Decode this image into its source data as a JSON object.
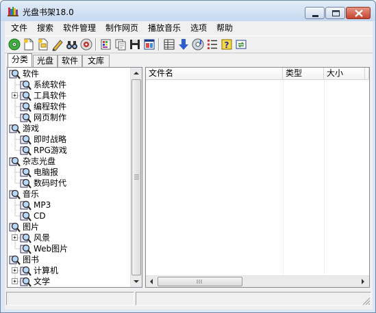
{
  "window": {
    "title": "光盘书架18.0",
    "icon": "bookshelf-icon"
  },
  "menu": [
    {
      "label": "文件"
    },
    {
      "label": "搜索"
    },
    {
      "label": "软件管理"
    },
    {
      "label": "制作网页"
    },
    {
      "label": "播放音乐"
    },
    {
      "label": "选项"
    },
    {
      "label": "帮助"
    }
  ],
  "toolbar": [
    {
      "icon": "disc-scan-icon"
    },
    {
      "icon": "new-file-icon"
    },
    {
      "icon": "new-folder-icon"
    },
    {
      "icon": "edit-pencil-icon"
    },
    {
      "icon": "binoculars-search-icon"
    },
    {
      "icon": "disc-player-icon"
    },
    {
      "icon": "color-palette-icon"
    },
    {
      "icon": "copy-icon"
    },
    {
      "icon": "save-icon"
    },
    {
      "icon": "window-layout-icon"
    },
    {
      "icon": "grid-view-icon"
    },
    {
      "icon": "arrow-down-icon"
    },
    {
      "icon": "disc-music-icon"
    },
    {
      "icon": "checklist-icon"
    },
    {
      "icon": "help-icon"
    },
    {
      "icon": "refresh-swap-icon"
    }
  ],
  "tabs": [
    {
      "label": "分类"
    },
    {
      "label": "光盘"
    },
    {
      "label": "软件"
    },
    {
      "label": "文库"
    }
  ],
  "tree": [
    {
      "label": "软件",
      "level": 0
    },
    {
      "label": "系统软件",
      "level": 1
    },
    {
      "label": "工具软件",
      "level": 1,
      "expandable": true
    },
    {
      "label": "编程软件",
      "level": 1
    },
    {
      "label": "网页制作",
      "level": 1
    },
    {
      "label": "游戏",
      "level": 0
    },
    {
      "label": "即时战略",
      "level": 1
    },
    {
      "label": "RPG游戏",
      "level": 1
    },
    {
      "label": "杂志光盘",
      "level": 0
    },
    {
      "label": "电脑报",
      "level": 1
    },
    {
      "label": "数码时代",
      "level": 1
    },
    {
      "label": "音乐",
      "level": 0
    },
    {
      "label": "MP3",
      "level": 1
    },
    {
      "label": "CD",
      "level": 1
    },
    {
      "label": "图片",
      "level": 0
    },
    {
      "label": "风景",
      "level": 1,
      "expandable": true
    },
    {
      "label": "Web图片",
      "level": 1
    },
    {
      "label": "图书",
      "level": 0
    },
    {
      "label": "计算机",
      "level": 1,
      "expandable": true
    },
    {
      "label": "文学",
      "level": 1,
      "expandable": true
    }
  ],
  "list": {
    "columns": [
      {
        "label": "文件名"
      },
      {
        "label": "类型"
      },
      {
        "label": "大小"
      }
    ],
    "rows": []
  },
  "statusbar": {
    "panes": [
      "",
      ""
    ]
  }
}
